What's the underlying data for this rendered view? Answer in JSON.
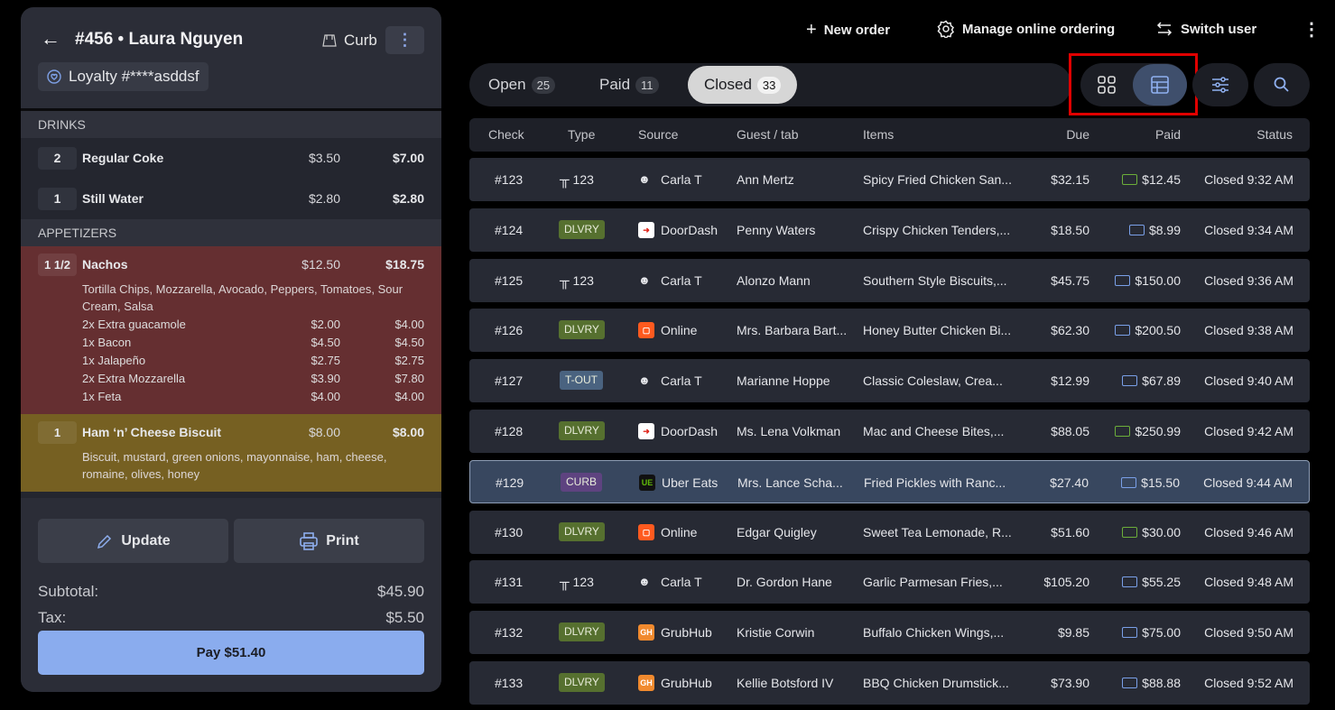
{
  "order": {
    "back_icon": "arrow-left-icon",
    "title": "#456 • Laura Nguyen",
    "type_label": "Curb",
    "loyalty": "Loyalty #****asddsf",
    "sections": [
      {
        "name": "DRINKS",
        "items": [
          {
            "qty": "2",
            "name": "Regular Coke",
            "price": "$3.50",
            "total": "$7.00"
          },
          {
            "qty": "1",
            "name": "Still Water",
            "price": "$2.80",
            "total": "$2.80"
          }
        ]
      },
      {
        "name": "APPETIZERS",
        "items": [
          {
            "qty": "1 1/2",
            "name": "Nachos",
            "price": "$12.50",
            "total": "$18.75",
            "color": "#652f31",
            "desc": "Tortilla Chips, Mozzarella, Avocado, Peppers, Tomatoes, Sour Cream, Salsa",
            "mods": [
              {
                "name": "2x Extra guacamole",
                "price": "$2.00",
                "total": "$4.00"
              },
              {
                "name": "1x Bacon",
                "price": "$4.50",
                "total": "$4.50"
              },
              {
                "name": "1x Jalapeño",
                "price": "$2.75",
                "total": "$2.75"
              },
              {
                "name": "2x Extra Mozzarella",
                "price": "$3.90",
                "total": "$7.80"
              },
              {
                "name": "1x Feta",
                "price": "$4.00",
                "total": "$4.00"
              }
            ]
          },
          {
            "qty": "1",
            "name": "Ham ‘n’ Cheese Biscuit",
            "price": "$8.00",
            "total": "$8.00",
            "color": "#766022",
            "desc": "Biscuit, mustard, green onions, mayonnaise, ham, cheese, romaine, olives, honey",
            "mods": []
          }
        ]
      }
    ],
    "update_label": "Update",
    "print_label": "Print",
    "subtotal_label": "Subtotal:",
    "subtotal": "$45.90",
    "tax_label": "Tax:",
    "tax": "$5.50",
    "pay_label": "Pay $51.40"
  },
  "toolbar": {
    "new_order": "New order",
    "manage": "Manage online ordering",
    "switch_user": "Switch user"
  },
  "tabs": [
    {
      "label": "Open",
      "count": "25"
    },
    {
      "label": "Paid",
      "count": "11"
    },
    {
      "label": "Closed",
      "count": "33",
      "active": true
    }
  ],
  "view_mode": "list",
  "highlight_color": "#e00000",
  "columns": [
    "Check",
    "Type",
    "Source",
    "Guest / tab",
    "Items",
    "Due",
    "Paid",
    "Status"
  ],
  "type_colors": {
    "DLVRY": "#56702f",
    "T-OUT": "#4a6380",
    "CURB": "#5e4380"
  },
  "rows": [
    {
      "check": "#123",
      "type": "table",
      "table": "123",
      "source": "Carla T",
      "src": "server",
      "guest": "Ann Mertz",
      "items": "Spicy Fried Chicken San...",
      "due": "$32.15",
      "pay": "cash",
      "paid": "$12.45",
      "status": "Closed 9:32 AM"
    },
    {
      "check": "#124",
      "type": "DLVRY",
      "source": "DoorDash",
      "src": "doordash",
      "guest": "Penny Waters",
      "items": "Crispy Chicken Tenders,...",
      "due": "$18.50",
      "pay": "card",
      "paid": "$8.99",
      "status": "Closed 9:34 AM"
    },
    {
      "check": "#125",
      "type": "table",
      "table": "123",
      "source": "Carla T",
      "src": "server",
      "guest": "Alonzo Mann",
      "items": "Southern Style Biscuits,...",
      "due": "$45.75",
      "pay": "card",
      "paid": "$150.00",
      "status": "Closed 9:36 AM"
    },
    {
      "check": "#126",
      "type": "DLVRY",
      "source": "Online",
      "src": "online",
      "guest": "Mrs. Barbara Bart...",
      "items": "Honey Butter Chicken Bi...",
      "due": "$62.30",
      "pay": "card",
      "paid": "$200.50",
      "status": "Closed 9:38 AM"
    },
    {
      "check": "#127",
      "type": "T-OUT",
      "source": "Carla T",
      "src": "server",
      "guest": "Marianne Hoppe",
      "items": "Classic Coleslaw, Crea...",
      "due": "$12.99",
      "pay": "card",
      "paid": "$67.89",
      "status": "Closed 9:40 AM"
    },
    {
      "check": "#128",
      "type": "DLVRY",
      "source": "DoorDash",
      "src": "doordash",
      "guest": "Ms. Lena Volkman",
      "items": "Mac and Cheese Bites,...",
      "due": "$88.05",
      "pay": "cash",
      "paid": "$250.99",
      "status": "Closed 9:42 AM"
    },
    {
      "check": "#129",
      "type": "CURB",
      "source": "Uber Eats",
      "src": "ubereats",
      "guest": "Mrs. Lance Scha...",
      "items": "Fried Pickles with Ranc...",
      "due": "$27.40",
      "pay": "card",
      "paid": "$15.50",
      "status": "Closed 9:44 AM",
      "selected": true
    },
    {
      "check": "#130",
      "type": "DLVRY",
      "source": "Online",
      "src": "online",
      "guest": "Edgar Quigley",
      "items": "Sweet Tea Lemonade, R...",
      "due": "$51.60",
      "pay": "cash",
      "paid": "$30.00",
      "status": "Closed 9:46 AM"
    },
    {
      "check": "#131",
      "type": "table",
      "table": "123",
      "source": "Carla T",
      "src": "server",
      "guest": "Dr. Gordon Hane",
      "items": "Garlic Parmesan Fries,...",
      "due": "$105.20",
      "pay": "card",
      "paid": "$55.25",
      "status": "Closed 9:48 AM"
    },
    {
      "check": "#132",
      "type": "DLVRY",
      "source": "GrubHub",
      "src": "grubhub",
      "guest": "Kristie Corwin",
      "items": "Buffalo Chicken Wings,...",
      "due": "$9.85",
      "pay": "card",
      "paid": "$75.00",
      "status": "Closed 9:50 AM"
    },
    {
      "check": "#133",
      "type": "DLVRY",
      "source": "GrubHub",
      "src": "grubhub",
      "guest": "Kellie Botsford IV",
      "items": "BBQ Chicken Drumstick...",
      "due": "$73.90",
      "pay": "card",
      "paid": "$88.88",
      "status": "Closed 9:52 AM"
    }
  ]
}
